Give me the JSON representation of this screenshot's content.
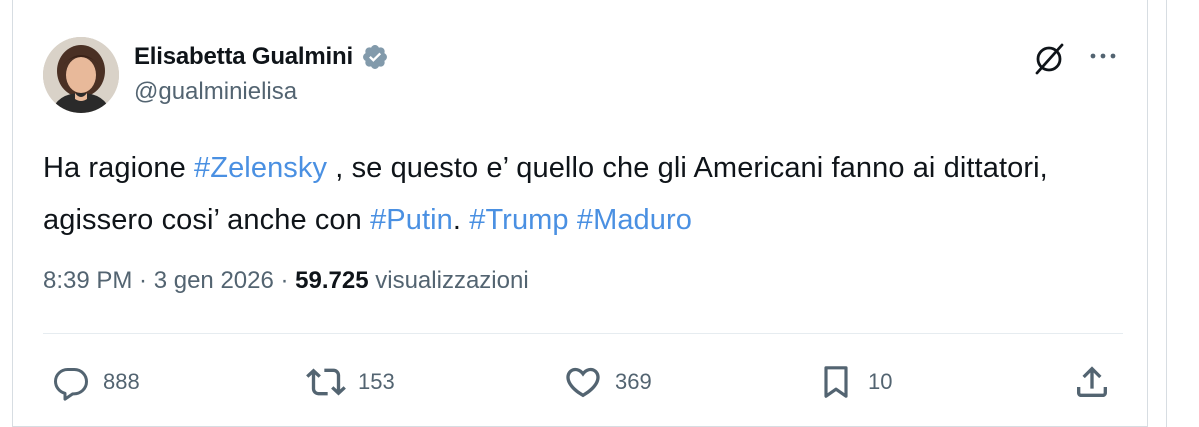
{
  "author": {
    "name": "Elisabetta Gualmini",
    "handle": "@gualminielisa"
  },
  "tweet": {
    "text_parts": [
      {
        "text": "Ha ragione ",
        "type": "text"
      },
      {
        "text": "#Zelensky",
        "type": "hashtag"
      },
      {
        "text": " , se questo e’ quello che gli Americani fanno ai dittatori, agissero cosi’ anche con ",
        "type": "text"
      },
      {
        "text": "#Putin",
        "type": "hashtag"
      },
      {
        "text": ". ",
        "type": "text"
      },
      {
        "text": "#Trump",
        "type": "hashtag"
      },
      {
        "text": " ",
        "type": "text"
      },
      {
        "text": "#Maduro",
        "type": "hashtag"
      }
    ]
  },
  "meta": {
    "time": "8:39 PM",
    "sep1": " · ",
    "date": "3 gen 2026",
    "sep2": " · ",
    "views_count": "59.725",
    "views_label": " visualizzazioni"
  },
  "actions": {
    "replies": "888",
    "retweets": "153",
    "likes": "369",
    "bookmarks": "10"
  },
  "icons": {
    "verified": "verified-badge-icon",
    "grok": "grok-icon",
    "more": "more-dots-icon",
    "reply": "reply-icon",
    "retweet": "retweet-icon",
    "like": "heart-icon",
    "bookmark": "bookmark-icon",
    "share": "share-icon"
  },
  "colors": {
    "hashtag": "#4a90e2",
    "secondary_text": "#536471",
    "verified": "#829aab"
  }
}
